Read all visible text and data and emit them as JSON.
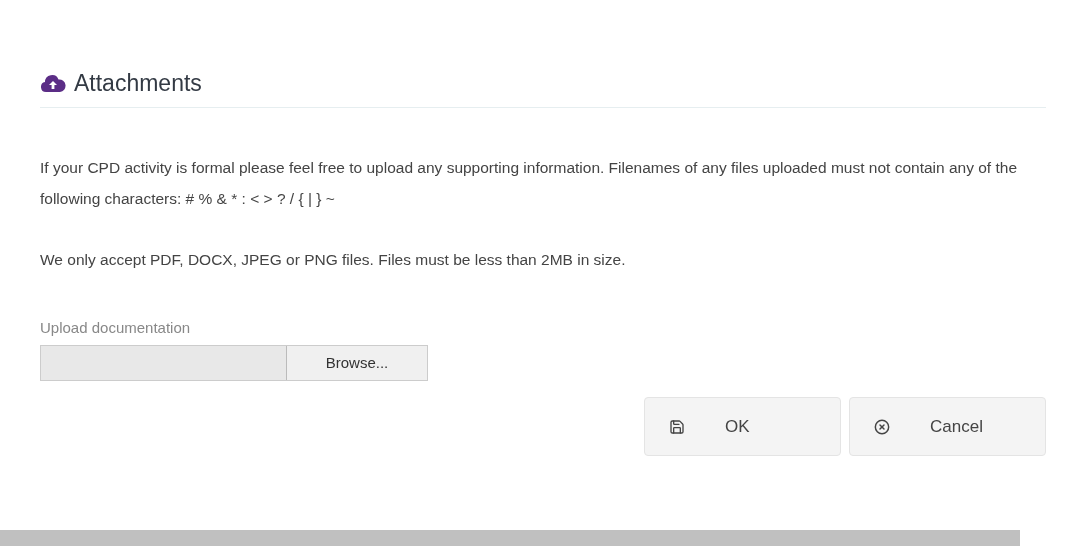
{
  "heading": "Attachments",
  "paragraphs": [
    "If your CPD activity is formal please feel free to upload any supporting information. Filenames of any files uploaded must not contain any of the following characters: # % & * : < > ? / { | } ~",
    "We only accept PDF, DOCX, JPEG or PNG files. Files must be less than 2MB in size."
  ],
  "upload": {
    "label": "Upload documentation",
    "button": "Browse..."
  },
  "buttons": [
    {
      "kind": "save",
      "label": "OK"
    },
    {
      "kind": "cancel",
      "label": "Cancel"
    }
  ]
}
